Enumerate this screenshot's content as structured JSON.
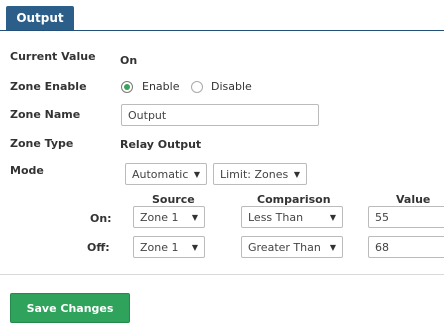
{
  "tab": {
    "label": "Output"
  },
  "rows": {
    "current_value": {
      "label": "Current Value",
      "value": "On"
    },
    "zone_enable": {
      "label": "Zone Enable",
      "option_enable": "Enable",
      "option_disable": "Disable",
      "selected": "Enable"
    },
    "zone_name": {
      "label": "Zone Name",
      "value": "Output"
    },
    "zone_type": {
      "label": "Zone Type",
      "value": "Relay Output"
    },
    "mode": {
      "label": "Mode",
      "mode_value": "Automatic",
      "limit_value": "Limit: Zones"
    }
  },
  "table": {
    "headers": {
      "source": "Source",
      "comparison": "Comparison",
      "value": "Value"
    },
    "on": {
      "label": "On:",
      "source": "Zone 1",
      "comparison": "Less Than",
      "value": "55"
    },
    "off": {
      "label": "Off:",
      "source": "Zone 1",
      "comparison": "Greater Than",
      "value": "68"
    }
  },
  "buttons": {
    "save": "Save Changes"
  },
  "colors": {
    "tab": "#2c5e8a",
    "save": "#2fa35c",
    "radio_selected": "#3aa35b"
  }
}
